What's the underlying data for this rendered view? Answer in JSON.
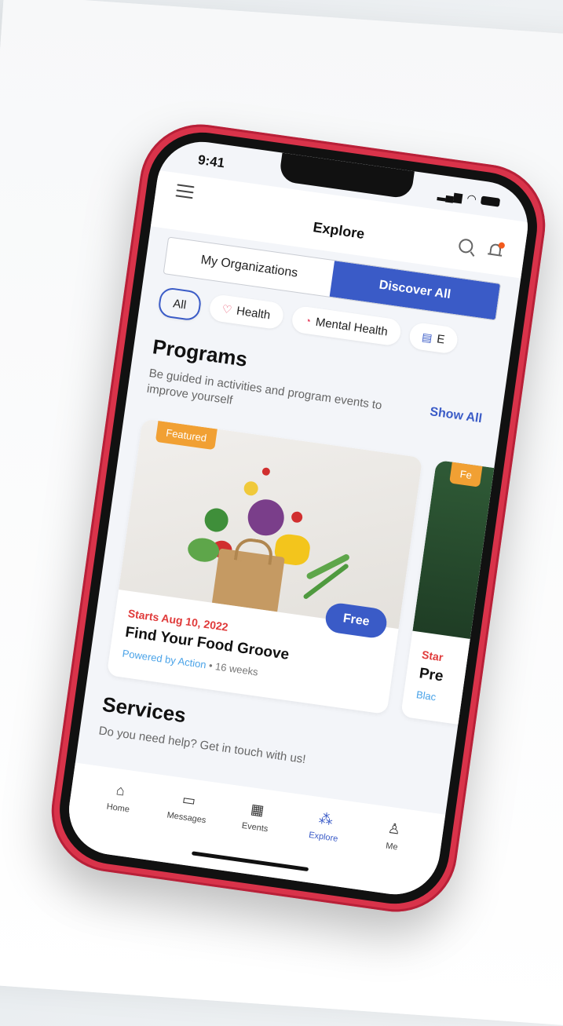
{
  "status": {
    "time": "9:41",
    "signal_icon": "signal-icon",
    "wifi_icon": "wifi-icon",
    "battery_icon": "battery-icon"
  },
  "header": {
    "title": "Explore",
    "menu_icon": "hamburger-menu-icon",
    "search_icon": "search-icon",
    "bell_icon": "notification-bell-icon"
  },
  "segments": [
    "My Organizations",
    "Discover All"
  ],
  "active_segment": "Discover All",
  "chips": [
    {
      "label": "All",
      "icon": ""
    },
    {
      "label": "Health",
      "icon": "heart-icon"
    },
    {
      "label": "Mental Health",
      "icon": "brain-icon"
    },
    {
      "label": "E",
      "icon": "book-icon"
    }
  ],
  "programs": {
    "title": "Programs",
    "description": "Be guided in activities and program events to improve yourself",
    "show_all": "Show All",
    "cards": [
      {
        "badge": "Featured",
        "date": "Starts Aug 10, 2022",
        "title": "Find Your Food Groove",
        "powered_by": "Powered by Action",
        "separator": "•",
        "duration": "16 weeks",
        "price": "Free"
      },
      {
        "badge": "Fe",
        "date": "Star",
        "title": "Pre",
        "powered_by": "Blac"
      }
    ]
  },
  "services": {
    "title": "Services",
    "description": "Do you need help? Get in touch with us!"
  },
  "nav": [
    {
      "label": "Home",
      "icon": "home-icon"
    },
    {
      "label": "Messages",
      "icon": "messages-icon"
    },
    {
      "label": "Events",
      "icon": "calendar-icon"
    },
    {
      "label": "Explore",
      "icon": "explore-icon"
    },
    {
      "label": "Me",
      "icon": "person-icon"
    }
  ],
  "active_nav": "Explore",
  "colors": {
    "primary": "#3a5bc7",
    "featured": "#f1a033",
    "date": "#e03a3a",
    "phone": "#d9334a"
  }
}
